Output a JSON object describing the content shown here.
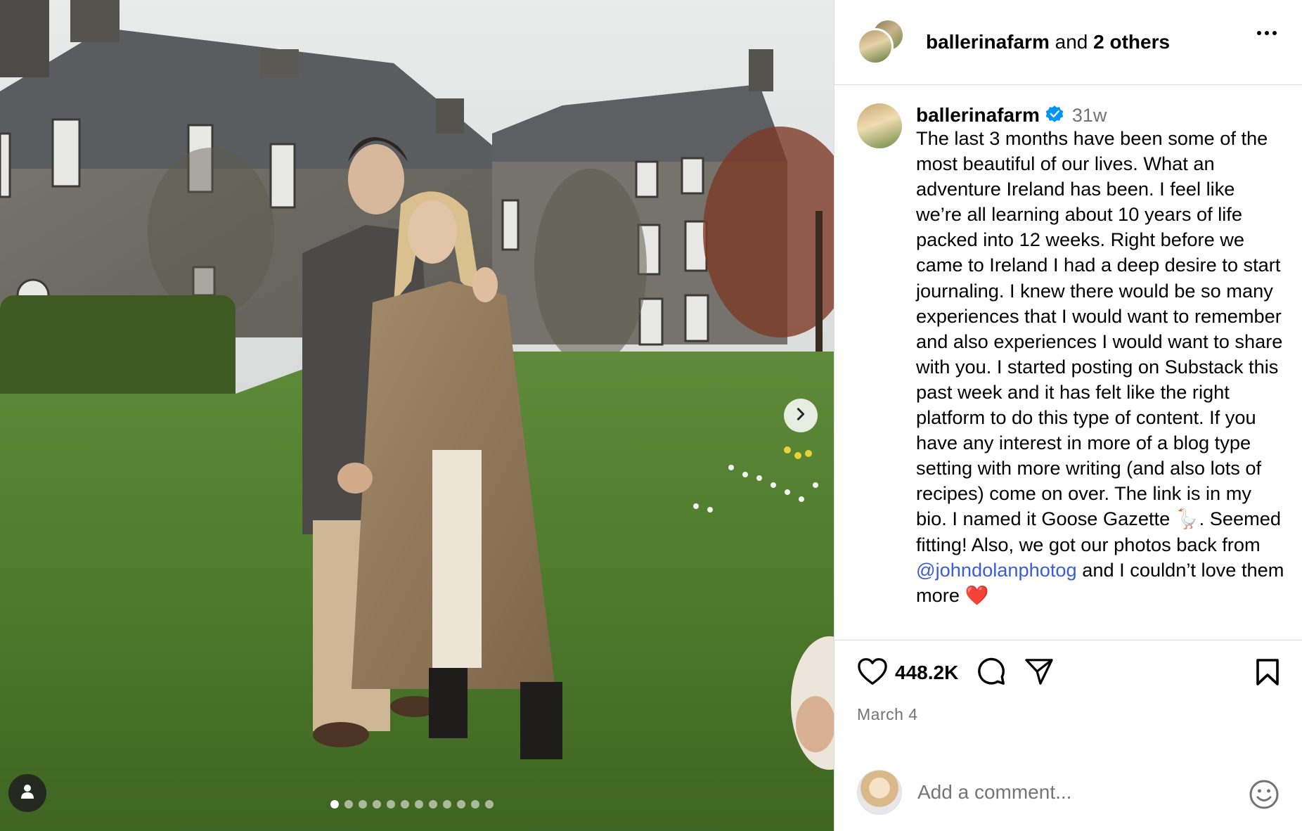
{
  "header": {
    "username": "ballerinafarm",
    "joiner": " and ",
    "others": "2 others"
  },
  "caption": {
    "username": "ballerinafarm",
    "time": "31w",
    "text_before_mention": "The last 3 months have been some of the most beautiful of our lives. What an adventure Ireland has been. I feel like we’re all learning about 10 years of life packed into 12 weeks. Right before we came to Ireland I had a deep desire to start journaling. I knew there would be so many experiences that I would want to remember and also experiences I would want to share with you. I started posting on Substack this past week and it has felt like the right platform to do this type of content. If you have any interest in more of a blog type setting with more writing (and also lots of recipes) come on over. The link is in my bio. I named it Goose Gazette 🪿. Seemed fitting!  Also, we got our photos back from ",
    "mention": "@johndolanphotog",
    "text_after_mention": " and I couldn’t love them more ❤️"
  },
  "actions": {
    "like_count": "448.2K",
    "date": "March 4"
  },
  "comment": {
    "placeholder": "Add a comment..."
  },
  "media": {
    "carousel_total": 12,
    "carousel_active": 1
  },
  "icons": {
    "verified": "verified-badge-icon",
    "like": "heart-icon",
    "comment": "comment-icon",
    "share": "send-icon",
    "save": "bookmark-icon",
    "emoji": "emoji-icon",
    "more": "more-options-icon",
    "next": "chevron-right-icon",
    "tag": "user-tag-icon"
  },
  "colors": {
    "verified": "#0095f6",
    "mention": "#3b5bdb",
    "secondary_text": "#737373",
    "divider": "#dbdbdb"
  }
}
